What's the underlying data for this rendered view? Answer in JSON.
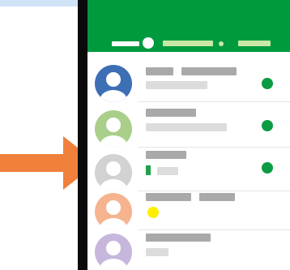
{
  "colors": {
    "top_strip": "#cfe3f7",
    "arrow": "#f0803c",
    "phone_frame": "#0a0a0a",
    "screen_bg": "#ffffff",
    "appbar_bg": "#009a3e",
    "appbar_text_light": "#ffffff",
    "appbar_text_muted": "#c9e8a6",
    "placeholder_dark": "#a9a9a9",
    "placeholder_light": "#dcdcdc",
    "online_green": "#0c9b42",
    "divider": "#e6e6e6",
    "highlight_green": "#1fa24a",
    "yellow": "#ffee00"
  },
  "appbar": {
    "title_icon": "placeholder-title-icon"
  },
  "contacts": [
    {
      "avatar_color": "#3d6fb5",
      "avatar_icon": "user-avatar-icon",
      "online": true,
      "indicator": "none"
    },
    {
      "avatar_color": "#a9cf8a",
      "avatar_icon": "user-avatar-icon",
      "online": true,
      "indicator": "none"
    },
    {
      "avatar_color": "#d2d2d2",
      "avatar_icon": "user-avatar-icon",
      "online": true,
      "indicator": "green-bar"
    },
    {
      "avatar_color": "#f6b38f",
      "avatar_icon": "user-avatar-icon",
      "online": false,
      "indicator": "yellow-dot"
    },
    {
      "avatar_color": "#c7b7dc",
      "avatar_icon": "user-avatar-icon",
      "online": false,
      "indicator": "none"
    }
  ]
}
